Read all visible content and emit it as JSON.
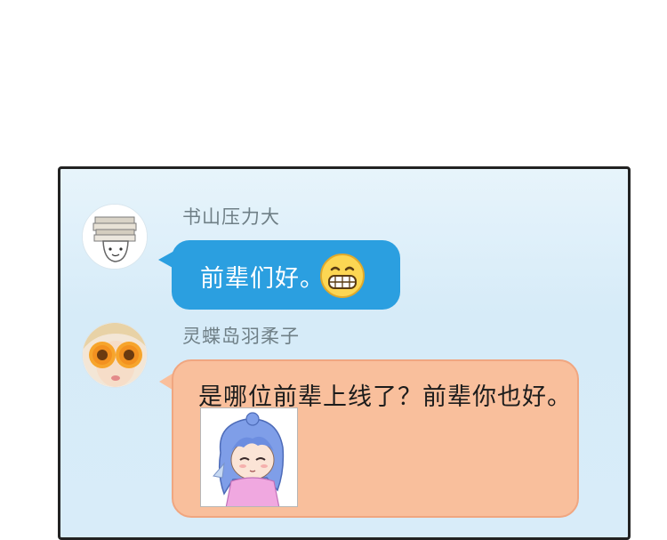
{
  "messages": [
    {
      "sender": "书山压力大",
      "text": "前辈们好。",
      "emoji_icon": "grinning-face-emoji",
      "avatar_icon": "book-stack-character-avatar"
    },
    {
      "sender": "灵蝶岛羽柔子",
      "text": "是哪位前辈上线了？前辈你也好。",
      "avatar_icon": "sunflower-eyes-girl-avatar",
      "sticker_icon": "blue-haired-girl-sticker"
    }
  ],
  "colors": {
    "blue_bubble": "#2b9fe0",
    "peach_bubble": "#f9bf9c",
    "panel_background": "#d8ecf9",
    "panel_border": "#222222"
  }
}
